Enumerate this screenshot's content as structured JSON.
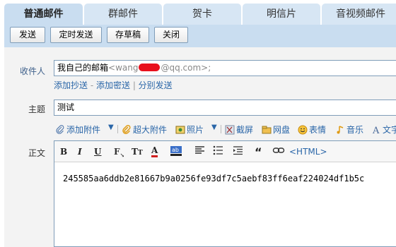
{
  "tabs": [
    {
      "label": "普通邮件",
      "active": true
    },
    {
      "label": "群邮件"
    },
    {
      "label": "贺卡"
    },
    {
      "label": "明信片"
    },
    {
      "label": "音视频邮件"
    }
  ],
  "toolbar": {
    "send": "发送",
    "scheduled_send": "定时发送",
    "save_draft": "存草稿",
    "close": "关闭"
  },
  "recipient": {
    "label": "收件人",
    "name": "我自己的邮箱",
    "addr_prefix": "<wang",
    "addr_suffix": "@qq.com>;"
  },
  "links": {
    "add_cc": "添加抄送",
    "dash": " - ",
    "add_bcc": "添加密送",
    "sep": " | ",
    "separate_send": "分别发送"
  },
  "subject": {
    "label": "主题",
    "value": "测试"
  },
  "attach_bar": {
    "add_attachment": "添加附件",
    "large_attachment": "超大附件",
    "photo": "照片",
    "screenshot": "截屏",
    "netdisk": "网盘",
    "emoji": "表情",
    "music": "音乐",
    "text": "文字"
  },
  "body": {
    "label": "正文",
    "html_toggle": "<HTML>",
    "content": "245585aa6ddb2e81667b9a0256fe93df7c5aebf83ff6eaf224024df1b5c"
  },
  "colors": {
    "tab_bg": "#d7e6f4",
    "toolbar_bg": "#c9ddf0",
    "link": "#2a66a8",
    "redaction": "#e8101d"
  }
}
